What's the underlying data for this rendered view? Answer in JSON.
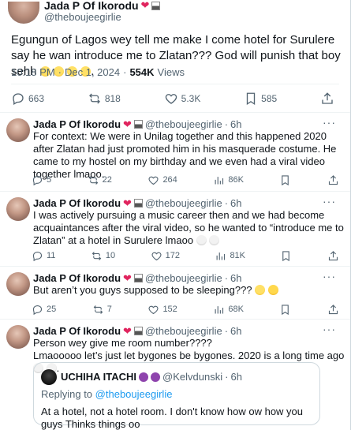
{
  "main_tweet": {
    "name": "Jada P Of Ikorodu",
    "handle": "@theboujeegirlie",
    "text": "Egungun of Lagos wey tell me make I come hotel for Surulere say he wan introduce me to Zlatan??? God will punish that boy sehh",
    "time": "10:18 PM",
    "date": "Dec 1, 2024",
    "views_count": "554K",
    "views_label": "Views",
    "replies": "663",
    "reposts": "818",
    "likes": "5.3K",
    "bookmarks": "585"
  },
  "replies": [
    {
      "name": "Jada P Of Ikorodu",
      "handle": "@theboujeegirlie",
      "age": "6h",
      "text": "For context: We were in Unilag together and this happened 2020 after Zlatan had just promoted him in his masquerade costume. He came to my hostel on my birthday and we even had a viral video together lmaoo.",
      "replies": "5",
      "reposts": "22",
      "likes": "264",
      "views": "86K"
    },
    {
      "name": "Jada P Of Ikorodu",
      "handle": "@theboujeegirlie",
      "age": "6h",
      "text": "I was actively pursuing a music career then and we had become acquaintances after the viral video, so he wanted to “introduce me to Zlatan” at a hotel in Surulere lmaoo",
      "replies": "11",
      "reposts": "10",
      "likes": "172",
      "views": "81K"
    },
    {
      "name": "Jada P Of Ikorodu",
      "handle": "@theboujeegirlie",
      "age": "6h",
      "text": "But aren’t you guys supposed to be sleeping???",
      "replies": "25",
      "reposts": "7",
      "likes": "152",
      "views": "68K"
    },
    {
      "name": "Jada P Of Ikorodu",
      "handle": "@theboujeegirlie",
      "age": "6h",
      "text_line1": "Person wey give me room number????",
      "text_line2": "Lmaooooo let’s just let bygones be bygones. 2020 is a long time ago"
    }
  ],
  "quote": {
    "name": "UCHIHA ITACHI",
    "handle": "@Kelvdunski",
    "age": "6h",
    "replying_prefix": "Replying to",
    "replying_handle": "@theboujeegirlie",
    "text": "At a hotel, not a hotel room. I don't know how ow how you guys Thinks things oo"
  },
  "separator": "·",
  "more": "···",
  "colors": {
    "text": "#0f1419",
    "secondary": "#536471",
    "link": "#1d9bf0",
    "heart": "#e0245e",
    "border": "#cfd9de"
  }
}
